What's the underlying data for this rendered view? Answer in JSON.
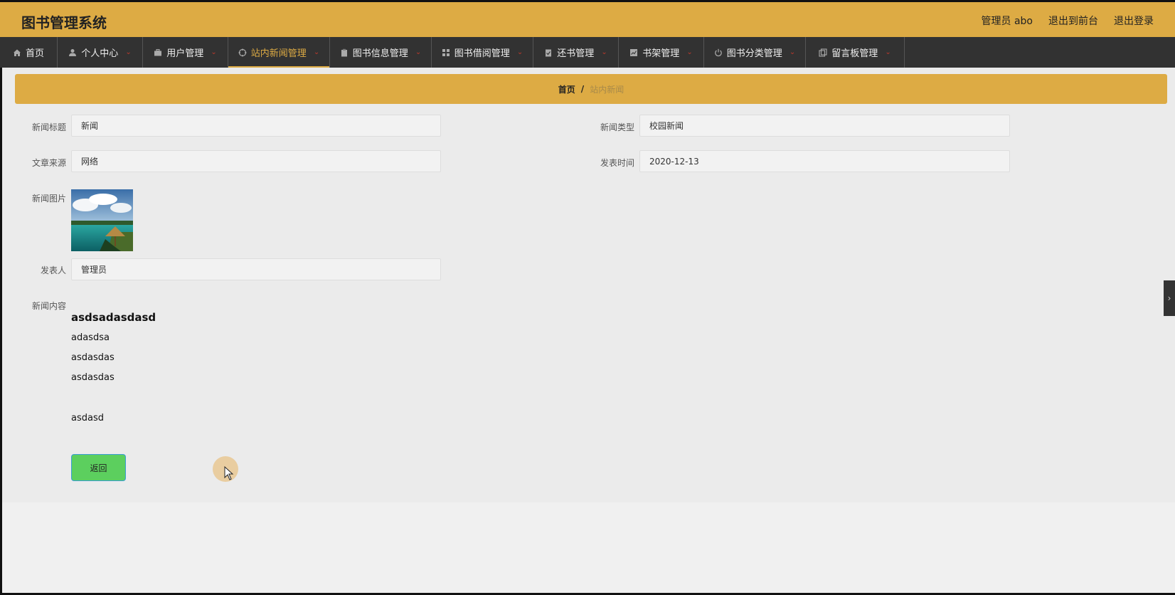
{
  "app": {
    "title": "图书管理系统"
  },
  "top_links": {
    "admin": "管理员 abo",
    "frontend": "退出到前台",
    "logout": "退出登录"
  },
  "nav": [
    {
      "label": "首页",
      "icon": "home-icon"
    },
    {
      "label": "个人中心",
      "icon": "user-icon"
    },
    {
      "label": "用户管理",
      "icon": "briefcase-icon"
    },
    {
      "label": "站内新闻管理",
      "icon": "crosshair-icon"
    },
    {
      "label": "图书信息管理",
      "icon": "clipboard-icon"
    },
    {
      "label": "图书借阅管理",
      "icon": "grid-icon"
    },
    {
      "label": "还书管理",
      "icon": "checklist-icon"
    },
    {
      "label": "书架管理",
      "icon": "chart-icon"
    },
    {
      "label": "图书分类管理",
      "icon": "power-icon"
    },
    {
      "label": "留言板管理",
      "icon": "copy-icon"
    }
  ],
  "breadcrumb": {
    "home": "首页",
    "sep": "/",
    "current": "站内新闻"
  },
  "form": {
    "title_label": "新闻标题",
    "title_value": "新闻",
    "type_label": "新闻类型",
    "type_value": "校园新闻",
    "source_label": "文章来源",
    "source_value": "网络",
    "date_label": "发表时间",
    "date_value": "2020-12-13",
    "image_label": "新闻图片",
    "author_label": "发表人",
    "author_value": "管理员",
    "content_label": "新闻内容"
  },
  "news_content": {
    "heading": "asdsadasdasd",
    "paragraphs": [
      "adasdsa",
      "asdasdas",
      "asdasdas",
      "",
      "asdasd"
    ]
  },
  "back_label": "返回",
  "colors": {
    "accent": "#ddab44",
    "nav_bg": "#323232",
    "button": "#5ccf5e"
  }
}
